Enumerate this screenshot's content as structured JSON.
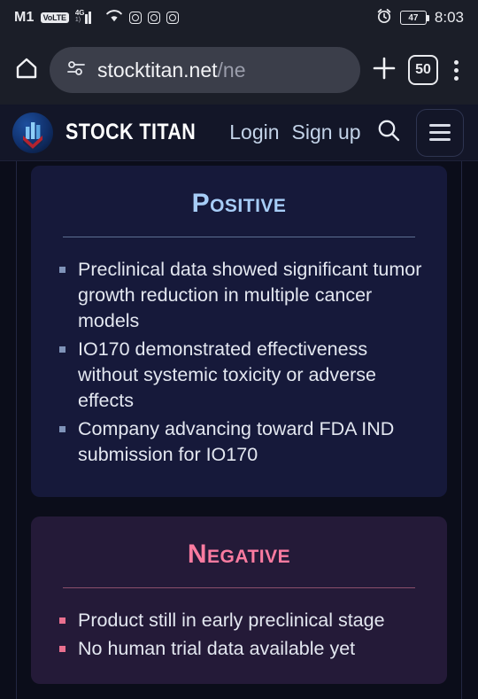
{
  "status_bar": {
    "carrier": "M1",
    "volte_badge": "VoLTE",
    "network_type": "4G",
    "network_sub": "1)",
    "app_icons": [
      "instagram-icon",
      "instagram-icon",
      "instagram-icon"
    ],
    "alarm_icon": "alarm-clock-icon",
    "battery_percent": "47",
    "time": "8:03"
  },
  "browser": {
    "home_icon": "home-icon",
    "site_settings_icon": "tune-sliders-icon",
    "url_host": "stocktitan.net",
    "url_path": "/ne",
    "url_full": "stocktitan.net/ne",
    "new_tab_icon": "plus-icon",
    "tab_count": "50",
    "menu_icon": "kebab-menu-icon"
  },
  "site_header": {
    "logo_icon": "stock-titan-logo-icon",
    "brand": "STOCK TITAN",
    "login_label": "Login",
    "signup_label": "Sign up",
    "search_icon": "search-icon",
    "menu_icon": "hamburger-menu-icon"
  },
  "cards": [
    {
      "key": "positive",
      "title": "Positive",
      "accent": "#a7cdf7",
      "background": "#16193a",
      "points": [
        "Preclinical data showed significant tumor growth reduction in multiple cancer models",
        "IO170 demonstrated effectiveness without systemic toxicity or adverse effects",
        "Company advancing toward FDA IND submission for IO170"
      ]
    },
    {
      "key": "negative",
      "title": "Negative",
      "accent": "#fa7ba0",
      "background": "#241a38",
      "points": [
        "Product still in early preclinical stage",
        "No human trial data available yet"
      ]
    }
  ]
}
